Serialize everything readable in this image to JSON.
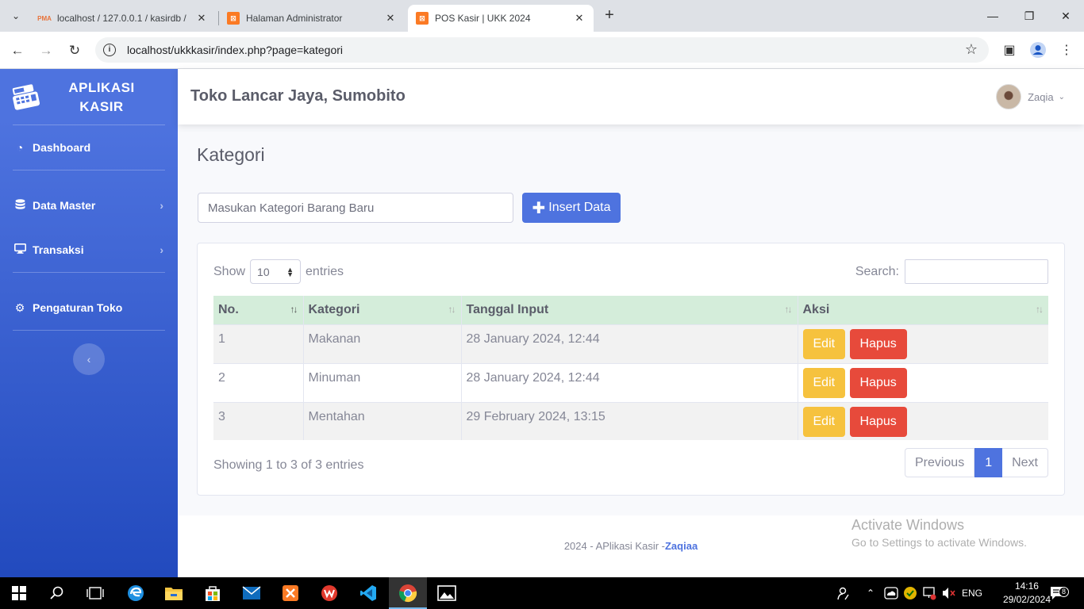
{
  "browser": {
    "tabs": [
      {
        "title": "localhost / 127.0.0.1 / kasirdb /",
        "favicon": "pma-icon"
      },
      {
        "title": "Halaman Administrator",
        "favicon": "xampp-icon"
      },
      {
        "title": "POS Kasir | UKK 2024",
        "favicon": "xampp-icon",
        "active": true
      }
    ],
    "url": "localhost/ukkkasir/index.php?page=kategori"
  },
  "sidebar": {
    "brand": "APLIKASI KASIR",
    "items": [
      {
        "label": "Dashboard",
        "icon": "dashboard-icon"
      },
      {
        "label": "Data Master",
        "icon": "database-icon"
      },
      {
        "label": "Transaksi",
        "icon": "desktop-icon"
      },
      {
        "label": "Pengaturan Toko",
        "icon": "cogs-icon"
      }
    ]
  },
  "topbar": {
    "store_name": "Toko Lancar Jaya, Sumobito",
    "user_name": "Zaqia"
  },
  "page": {
    "title": "Kategori",
    "input_placeholder": "Masukan Kategori Barang Baru",
    "insert_label": "Insert Data"
  },
  "datatable": {
    "show_label": "Show",
    "length_value": "10",
    "entries_label": "entries",
    "search_label": "Search:",
    "columns": [
      "No.",
      "Kategori",
      "Tanggal Input",
      "Aksi"
    ],
    "rows": [
      {
        "no": "1",
        "kategori": "Makanan",
        "tanggal": "28 January 2024, 12:44"
      },
      {
        "no": "2",
        "kategori": "Minuman",
        "tanggal": "28 January 2024, 12:44"
      },
      {
        "no": "3",
        "kategori": "Mentahan",
        "tanggal": "29 February 2024, 13:15"
      }
    ],
    "edit_label": "Edit",
    "delete_label": "Hapus",
    "info": "Showing 1 to 3 of 3 entries",
    "pager": {
      "previous": "Previous",
      "current": "1",
      "next": "Next"
    }
  },
  "footer": {
    "text": "2024 - APlikasi Kasir -",
    "author": "Zaqiaa"
  },
  "watermark": {
    "line1": "Activate Windows",
    "line2": "Go to Settings to activate Windows."
  },
  "taskbar": {
    "lang": "ENG",
    "time": "14:16",
    "date": "29/02/2024",
    "notif_count": "8"
  },
  "colors": {
    "primary": "#4e73df",
    "warning": "#f6c23e",
    "danger": "#e74a3b",
    "header_green": "#d4edda"
  }
}
